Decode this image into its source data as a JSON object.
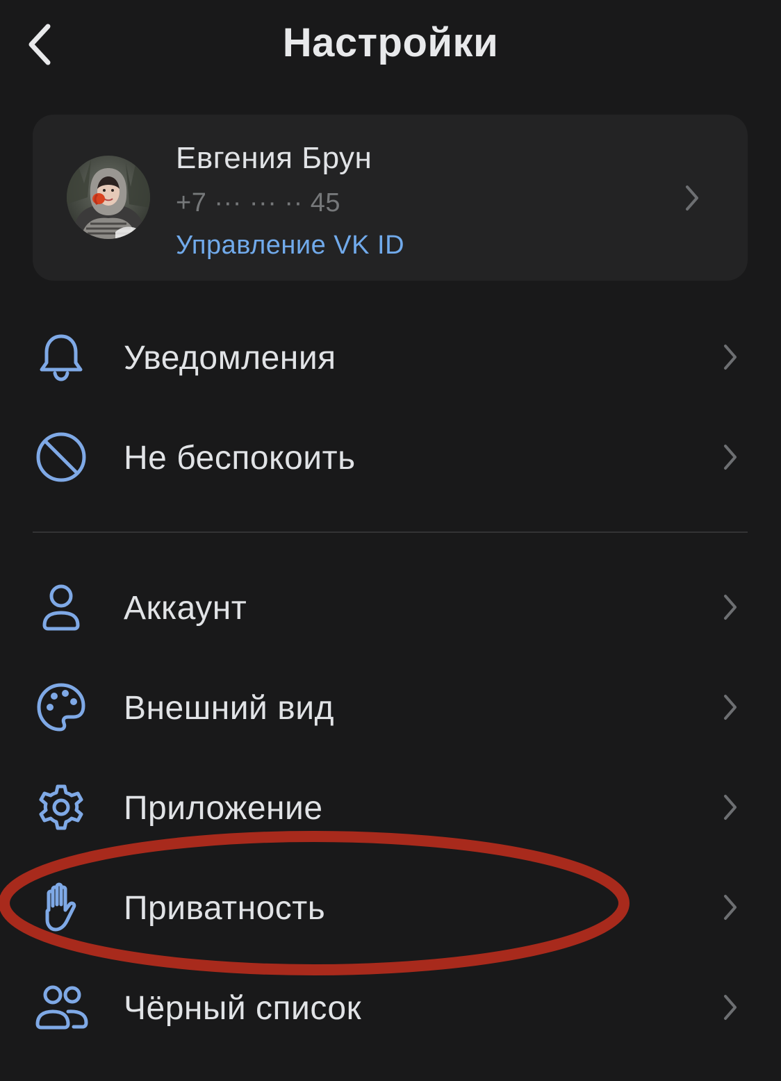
{
  "header": {
    "title": "Настройки",
    "back_icon": "chevron-left-icon"
  },
  "profile": {
    "name": "Евгения Брун",
    "phone": "+7 ··· ··· ·· 45",
    "link": "Управление VK ID",
    "avatar": "user-photo"
  },
  "menu": {
    "items": [
      {
        "label": "Уведомления",
        "icon": "bell-icon"
      },
      {
        "label": "Не беспокоить",
        "icon": "do-not-disturb-icon"
      },
      {
        "label": "Аккаунт",
        "icon": "user-icon"
      },
      {
        "label": "Внешний вид",
        "icon": "palette-icon"
      },
      {
        "label": "Приложение",
        "icon": "gear-icon"
      },
      {
        "label": "Приватность",
        "icon": "hand-icon"
      },
      {
        "label": "Чёрный список",
        "icon": "users-icon"
      }
    ]
  },
  "colors": {
    "background": "#19191a",
    "card": "#232324",
    "accent": "#71aaeb",
    "icon": "#7fa9e6",
    "text": "#e1e3e6",
    "secondary_text": "#76787a",
    "annotation": "#a82a1c"
  }
}
